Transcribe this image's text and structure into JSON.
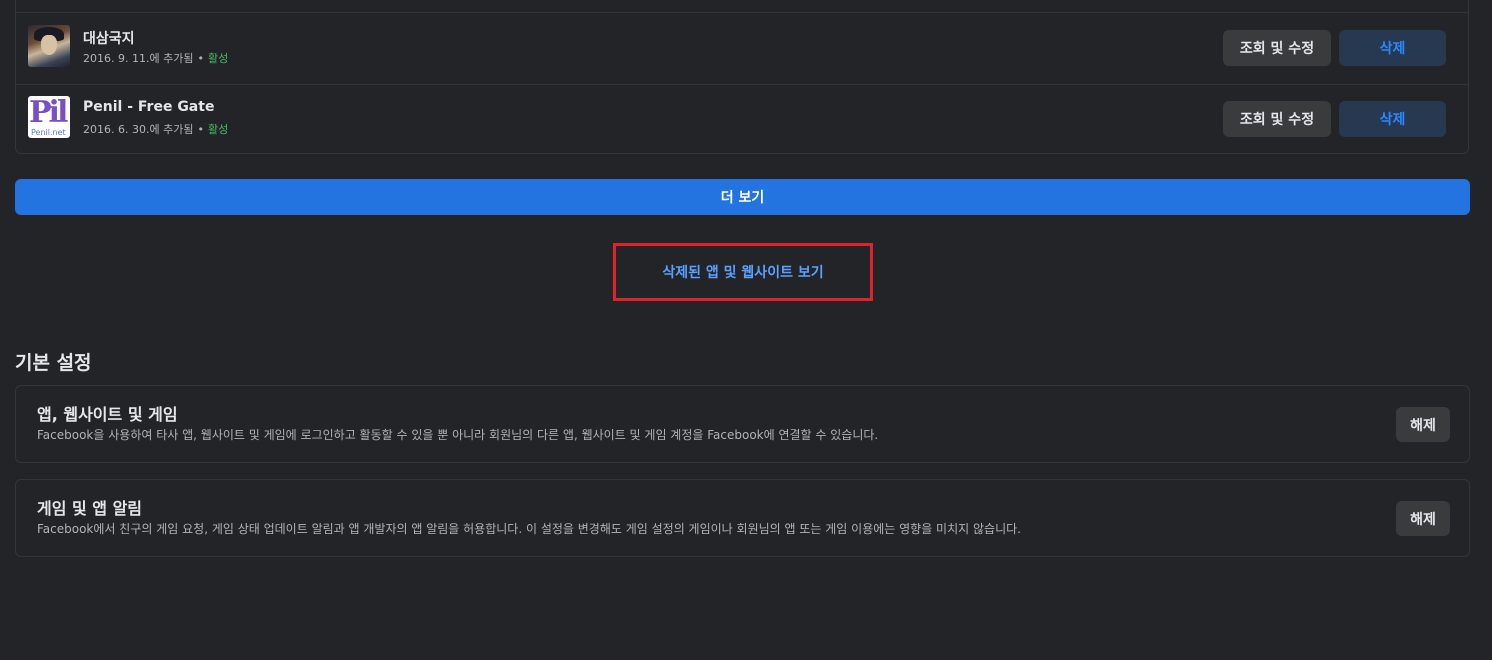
{
  "apps": [
    {
      "name": "대삼국지",
      "added": "2016. 9. 11.에 추가됨",
      "dot": "•",
      "status": "활성",
      "view_label": "조회 및 수정",
      "remove_label": "삭제",
      "thumbnail": "warrior-portrait"
    },
    {
      "name": "Penil - Free Gate",
      "added": "2016. 6. 30.에 추가됨",
      "dot": "•",
      "status": "활성",
      "view_label": "조회 및 수정",
      "remove_label": "삭제",
      "thumbnail": "penil-logo",
      "thumbnail_text": "Pil",
      "thumbnail_subtext": "Penil.net"
    }
  ],
  "see_more_label": "더 보기",
  "removed_link_label": "삭제된 앱 및 웹사이트 보기",
  "highlight_color": "#e0222f",
  "preferences": {
    "title": "기본 설정",
    "items": [
      {
        "title": "앱, 웹사이트 및 게임",
        "description": "Facebook을 사용하여 타사 앱, 웹사이트 및 게임에 로그인하고 활동할 수 있을 뿐 아니라 회원님의 다른 앱, 웹사이트 및 게임 계정을 Facebook에 연결할 수 있습니다.",
        "button_label": "해제"
      },
      {
        "title": "게임 및 앱 알림",
        "description": "Facebook에서 친구의 게임 요청, 게임 상태 업데이트 알림과 앱 개발자의 앱 알림을 허용합니다. 이 설정을 변경해도 게임 설정의 게임이나 회원님의 앱 또는 게임 이용에는 영향을 미치지 않습니다.",
        "button_label": "해제"
      }
    ]
  },
  "colors": {
    "background": "#232427",
    "primary": "#2374e1",
    "link": "#5aa1ff",
    "status_active": "#45bd62"
  }
}
